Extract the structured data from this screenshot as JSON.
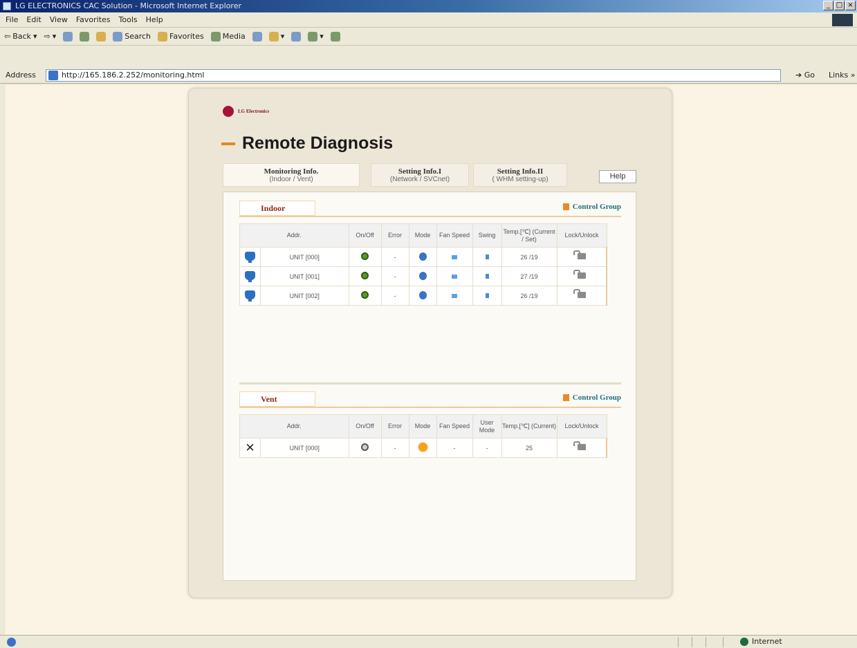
{
  "browser": {
    "title": "LG ELECTRONICS CAC Solution - Microsoft Internet Explorer",
    "menu": [
      "File",
      "Edit",
      "View",
      "Favorites",
      "Tools",
      "Help"
    ],
    "toolbar": {
      "back": "Back",
      "search": "Search",
      "favorites": "Favorites",
      "media": "Media"
    },
    "address_label": "Address",
    "url": "http://165.186.2.252/monitoring.html",
    "go": "Go",
    "links": "Links",
    "status_zone": "Internet"
  },
  "page": {
    "logo_text": "LG Electronics",
    "heading": "Remote Diagnosis",
    "help": "Help",
    "tabs": [
      {
        "title": "Monitoring Info.",
        "sub": "(Indoor / Vent)",
        "active": true
      },
      {
        "title": "Setting Info.I",
        "sub": "(Network / SVCnet)",
        "active": false
      },
      {
        "title": "Setting Info.II",
        "sub": "( WHM setting-up)",
        "active": false
      }
    ]
  },
  "indoor": {
    "label": "Indoor",
    "control_group": "Control Group",
    "headers": [
      "Addr.",
      "On/Off",
      "Error",
      "Mode",
      "Fan Speed",
      "Swing",
      "Temp.[℃] (Current / Set)",
      "Lock/Unlock"
    ],
    "rows": [
      {
        "addr": "UNIT [000]",
        "error": "-",
        "temp": "26 /19"
      },
      {
        "addr": "UNIT [001]",
        "error": "-",
        "temp": "27 /19"
      },
      {
        "addr": "UNIT [002]",
        "error": "-",
        "temp": "26 /19"
      }
    ]
  },
  "vent": {
    "label": "Vent",
    "control_group": "Control Group",
    "headers": [
      "Addr.",
      "On/Off",
      "Error",
      "Mode",
      "Fan Speed",
      "User Mode",
      "Temp.[℃] (Current)",
      "Lock/Unlock"
    ],
    "rows": [
      {
        "addr": "UNIT [000]",
        "error": "-",
        "fan": "-",
        "user_mode": "-",
        "temp": "25"
      }
    ]
  }
}
